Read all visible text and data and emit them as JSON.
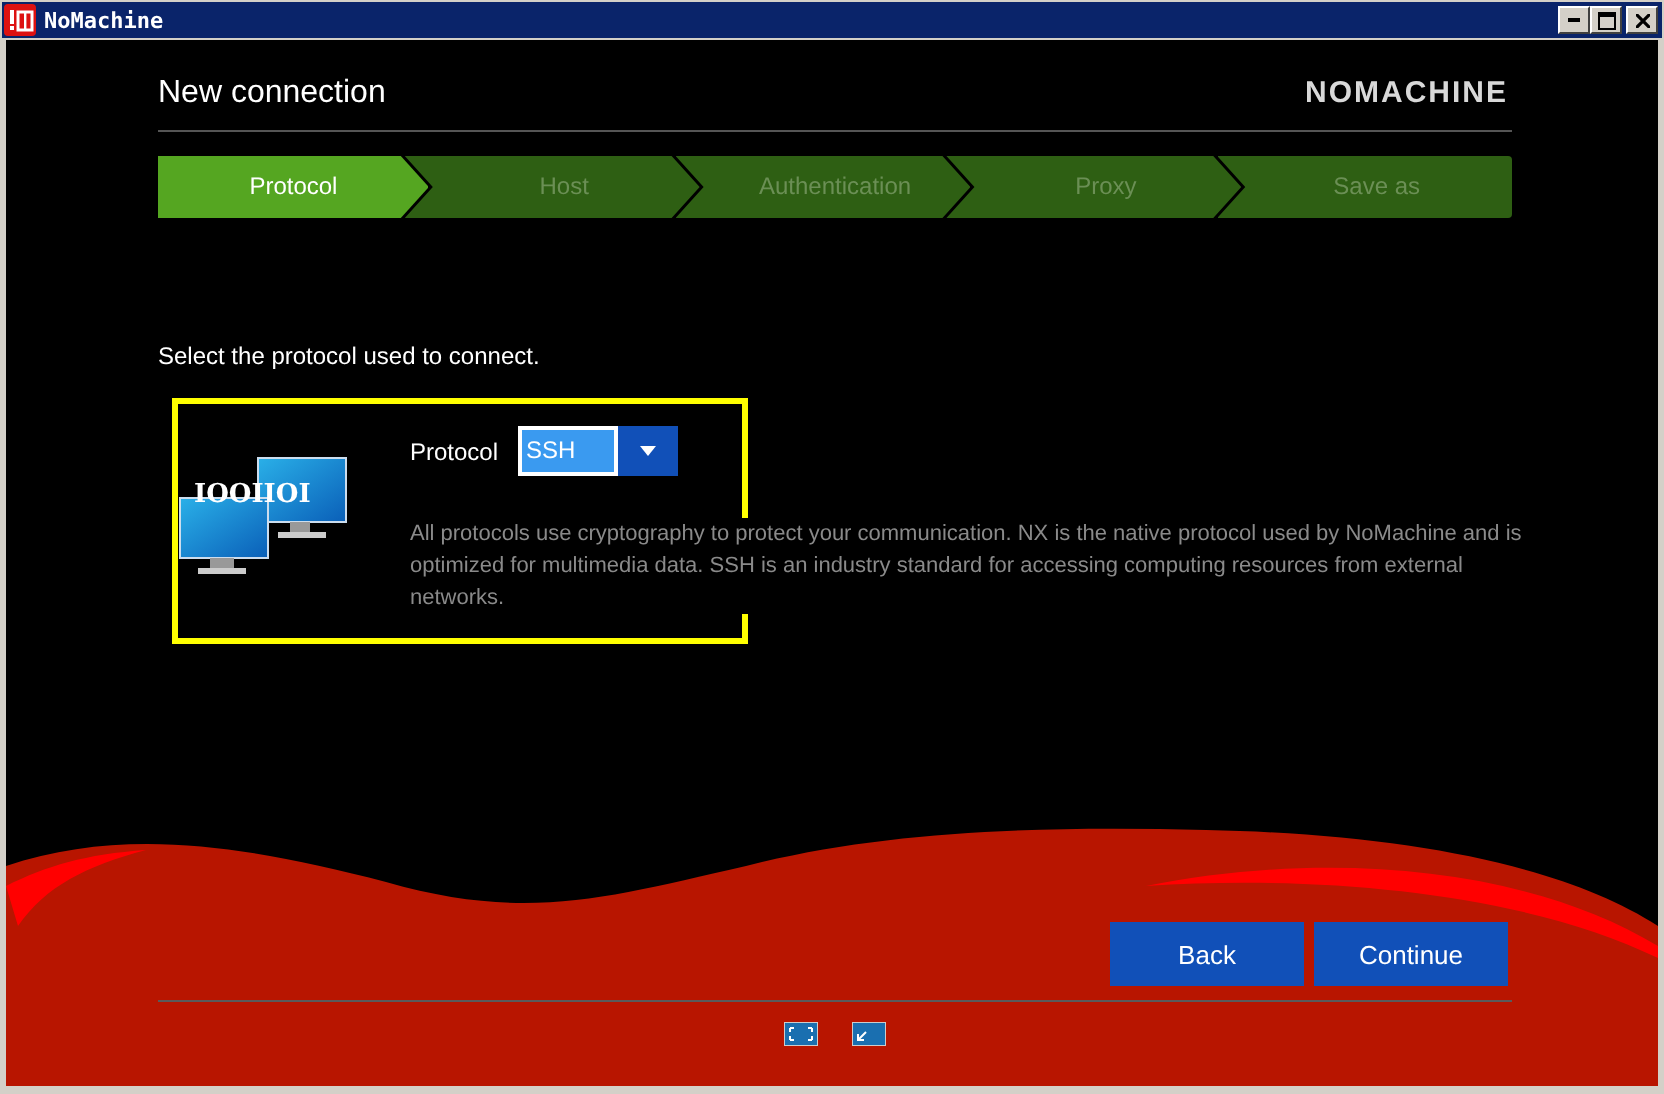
{
  "window": {
    "title": "NoMachine"
  },
  "header": {
    "title": "New connection",
    "logo": "NOMACHINE"
  },
  "steps": [
    {
      "label": "Protocol",
      "selected": true
    },
    {
      "label": "Host",
      "selected": false
    },
    {
      "label": "Authentication",
      "selected": false
    },
    {
      "label": "Proxy",
      "selected": false
    },
    {
      "label": "Save as",
      "selected": false
    }
  ],
  "prompt": "Select the protocol used to connect.",
  "protocol_section": {
    "highlighted": true,
    "icon_text": "IOOIIOI",
    "label": "Protocol",
    "value": "SSH",
    "description": "All protocols use cryptography to protect your communication. NX is the native protocol used by NoMachine and is optimized for multimedia data. SSH is an industry standard for accessing computing resources from external networks."
  },
  "buttons": [
    "Back",
    "Continue"
  ]
}
